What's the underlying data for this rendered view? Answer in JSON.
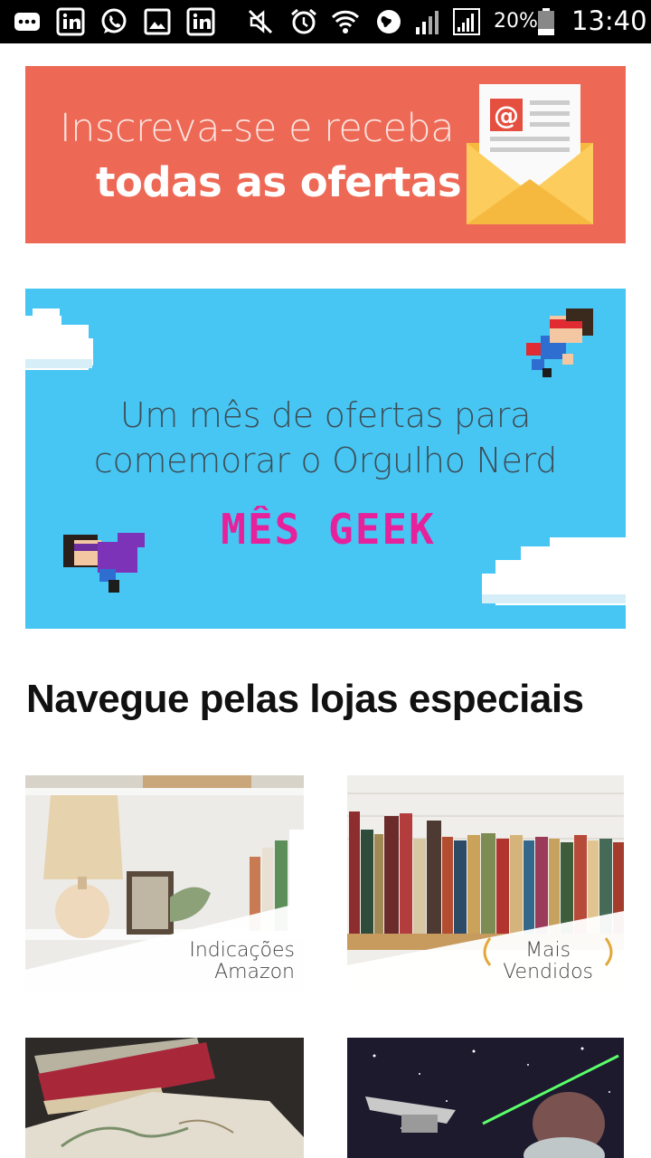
{
  "status_bar": {
    "icons": [
      "messaging-icon",
      "linkedin-icon",
      "whatsapp-icon",
      "gallery-icon",
      "linkedin-icon",
      "mute-icon",
      "alarm-icon",
      "wifi-icon",
      "vpn-icon",
      "signal-icon",
      "signal-icon",
      "battery-icon"
    ],
    "battery_percent": "20%",
    "time": "13:40"
  },
  "banner_subscribe": {
    "line1": "Inscreva-se e receba",
    "line2": "todas as ofertas",
    "background": "#ed6955"
  },
  "banner_geek": {
    "line1": "Um mês de ofertas para",
    "line2": "comemorar o Orgulho Nerd",
    "title": "MÊS GEEK",
    "background": "#47c6f4",
    "title_color": "#e6219b"
  },
  "section_title": "Navegue pelas lojas especiais",
  "stores": [
    {
      "label_line1": "Indicações",
      "label_line2": "Amazon"
    },
    {
      "label_line1": "Mais",
      "label_line2": "Vendidos"
    },
    {
      "label_line1": "",
      "label_line2": ""
    },
    {
      "label_line1": "",
      "label_line2": ""
    }
  ]
}
